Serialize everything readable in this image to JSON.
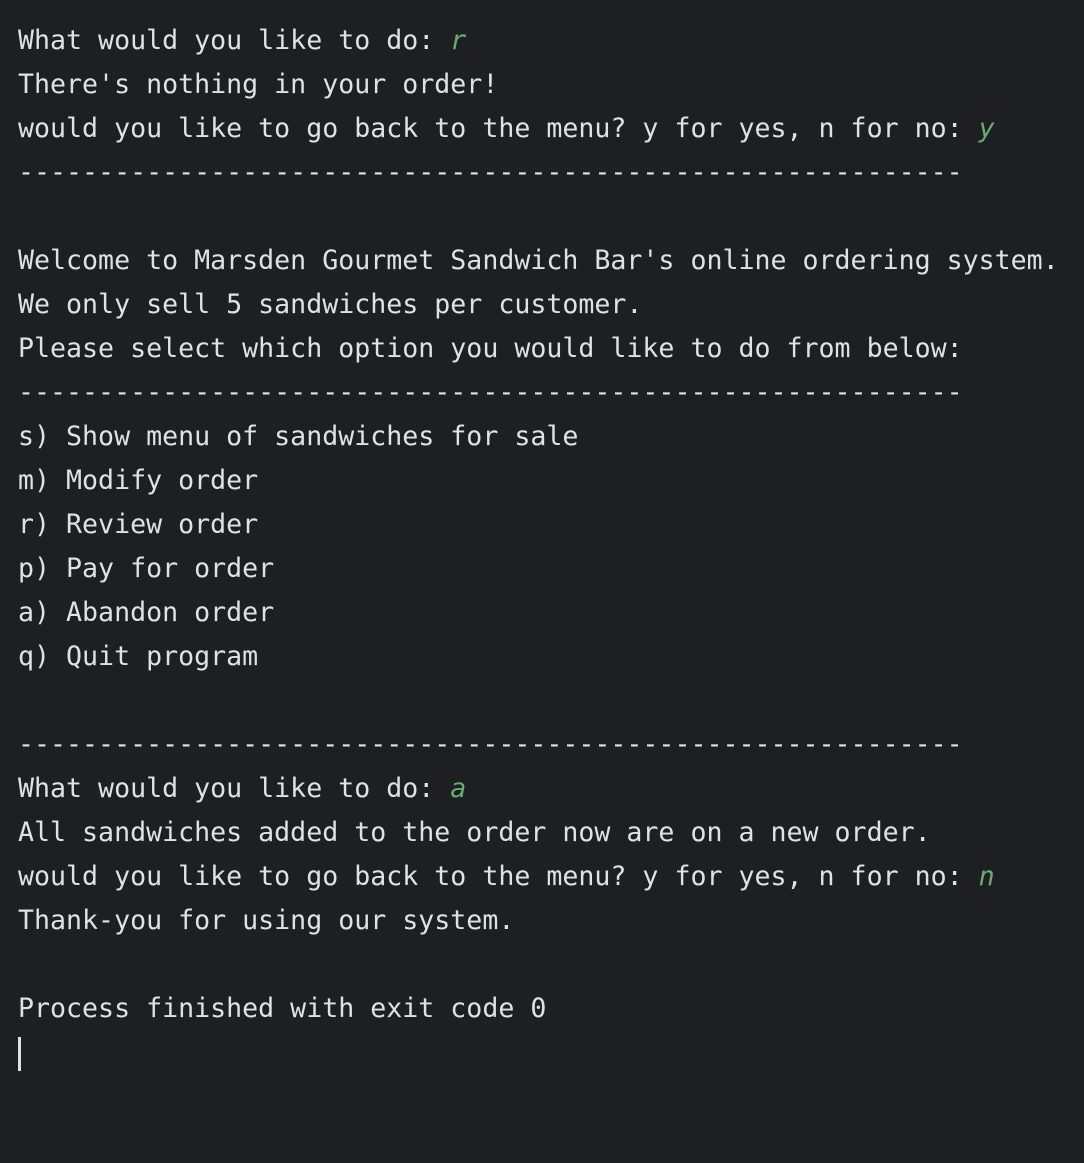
{
  "console": {
    "lines": [
      {
        "text": "What would you like to do: ",
        "input": "r"
      },
      {
        "text": "There's nothing in your order!"
      },
      {
        "text": "would you like to go back to the menu? y for yes, n for no: ",
        "input": "y"
      },
      {
        "text": "-----------------------------------------------------------"
      },
      {
        "text": ""
      },
      {
        "text": "Welcome to Marsden Gourmet Sandwich Bar's online ordering system."
      },
      {
        "text": "We only sell 5 sandwiches per customer."
      },
      {
        "text": "Please select which option you would like to do from below:"
      },
      {
        "text": "-----------------------------------------------------------"
      },
      {
        "text": "s) Show menu of sandwiches for sale"
      },
      {
        "text": "m) Modify order"
      },
      {
        "text": "r) Review order"
      },
      {
        "text": "p) Pay for order"
      },
      {
        "text": "a) Abandon order"
      },
      {
        "text": "q) Quit program"
      },
      {
        "text": ""
      },
      {
        "text": "-----------------------------------------------------------"
      },
      {
        "text": "What would you like to do: ",
        "input": "a"
      },
      {
        "text": "All sandwiches added to the order now are on a new order."
      },
      {
        "text": "would you like to go back to the menu? y for yes, n for no: ",
        "input": "n"
      },
      {
        "text": "Thank-you for using our system."
      },
      {
        "text": ""
      },
      {
        "text": "Process finished with exit code 0"
      }
    ]
  },
  "colors": {
    "background": "#1e1f22",
    "text": "#dfe1e5",
    "user_input": "#6aab73"
  }
}
